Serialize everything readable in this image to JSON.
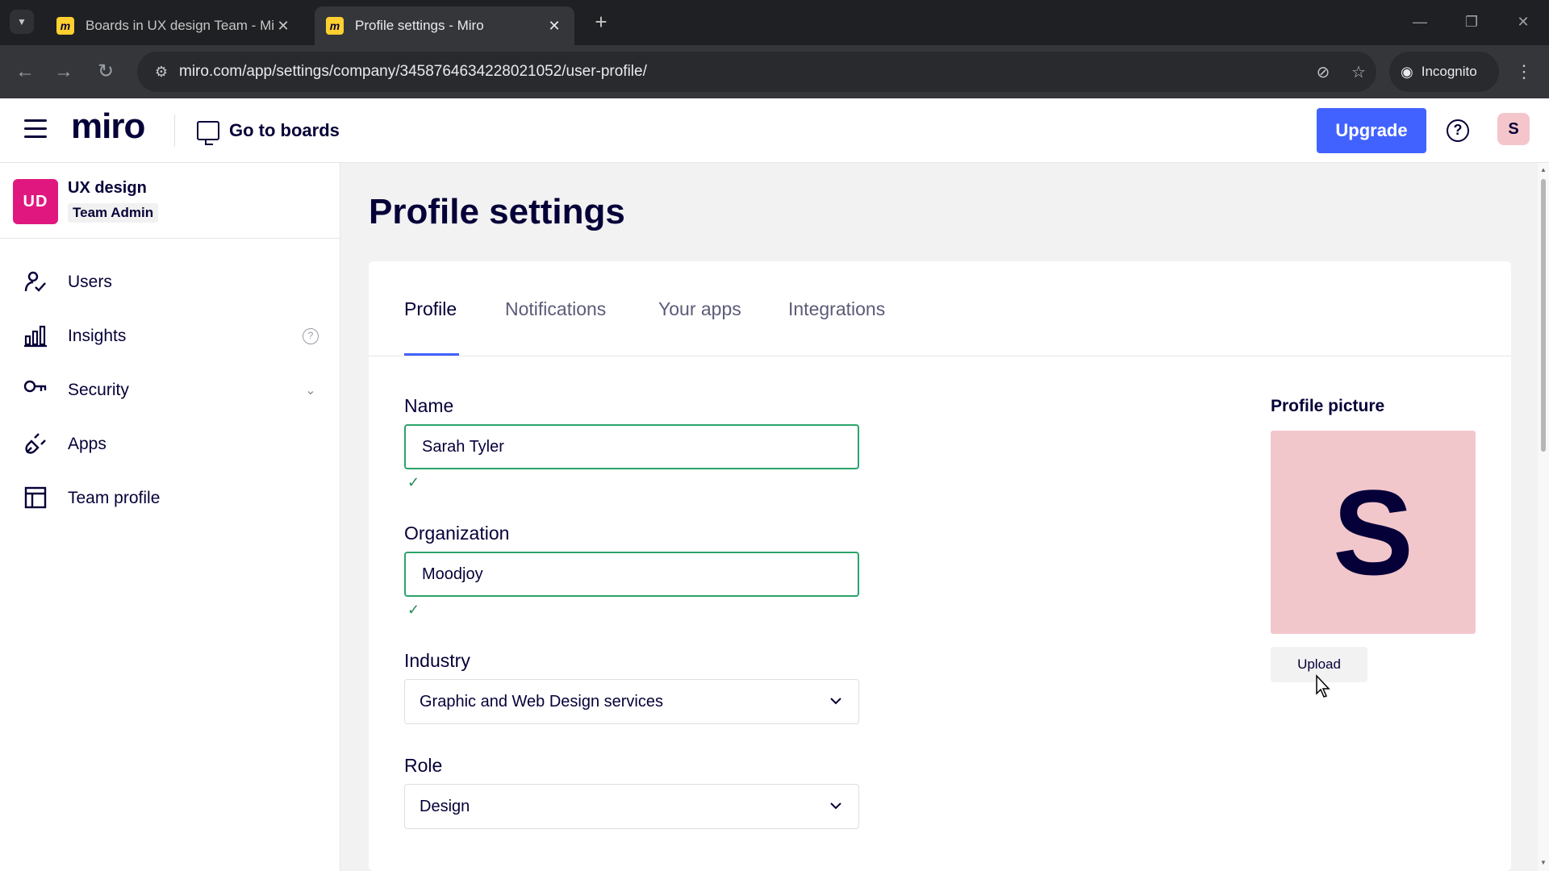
{
  "browser": {
    "tabs": [
      {
        "title": "Boards in UX design Team - Mi",
        "favicon": "miro-favicon"
      },
      {
        "title": "Profile settings - Miro",
        "favicon": "miro-favicon"
      }
    ],
    "url": "miro.com/app/settings/company/3458764634228021052/user-profile/",
    "incognito_label": "Incognito"
  },
  "header": {
    "logo": "miro",
    "go_to_boards": "Go to boards",
    "upgrade": "Upgrade",
    "avatar_initial": "S"
  },
  "sidebar": {
    "team": {
      "initials": "UD",
      "name": "UX design",
      "role": "Team Admin"
    },
    "items": [
      {
        "label": "Users",
        "icon": "users-icon"
      },
      {
        "label": "Insights",
        "icon": "bar-chart-icon"
      },
      {
        "label": "Security",
        "icon": "key-icon"
      },
      {
        "label": "Apps",
        "icon": "plug-icon"
      },
      {
        "label": "Team profile",
        "icon": "layout-icon"
      }
    ]
  },
  "main": {
    "title": "Profile settings",
    "tabs": [
      {
        "label": "Profile"
      },
      {
        "label": "Notifications"
      },
      {
        "label": "Your apps"
      },
      {
        "label": "Integrations"
      }
    ],
    "form": {
      "name": {
        "label": "Name",
        "value": "Sarah Tyler"
      },
      "organization": {
        "label": "Organization",
        "value": "Moodjoy"
      },
      "industry": {
        "label": "Industry",
        "value": "Graphic and Web Design services"
      },
      "role": {
        "label": "Role",
        "value": "Design"
      }
    },
    "profile_picture": {
      "label": "Profile picture",
      "initial": "S",
      "upload": "Upload"
    }
  },
  "colors": {
    "accent": "#4262ff",
    "team_avatar": "#e0177e",
    "profile_bg": "#f2c7cc",
    "valid_border": "#2ba36b"
  }
}
